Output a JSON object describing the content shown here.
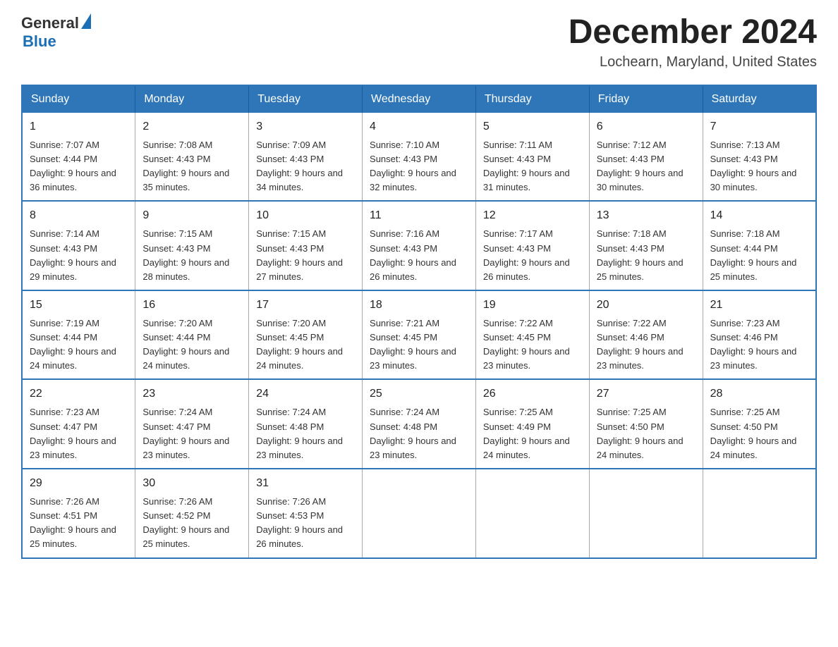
{
  "header": {
    "logo_general": "General",
    "logo_blue": "Blue",
    "month_title": "December 2024",
    "location": "Lochearn, Maryland, United States"
  },
  "weekdays": [
    "Sunday",
    "Monday",
    "Tuesday",
    "Wednesday",
    "Thursday",
    "Friday",
    "Saturday"
  ],
  "weeks": [
    [
      {
        "day": "1",
        "sunrise": "Sunrise: 7:07 AM",
        "sunset": "Sunset: 4:44 PM",
        "daylight": "Daylight: 9 hours and 36 minutes."
      },
      {
        "day": "2",
        "sunrise": "Sunrise: 7:08 AM",
        "sunset": "Sunset: 4:43 PM",
        "daylight": "Daylight: 9 hours and 35 minutes."
      },
      {
        "day": "3",
        "sunrise": "Sunrise: 7:09 AM",
        "sunset": "Sunset: 4:43 PM",
        "daylight": "Daylight: 9 hours and 34 minutes."
      },
      {
        "day": "4",
        "sunrise": "Sunrise: 7:10 AM",
        "sunset": "Sunset: 4:43 PM",
        "daylight": "Daylight: 9 hours and 32 minutes."
      },
      {
        "day": "5",
        "sunrise": "Sunrise: 7:11 AM",
        "sunset": "Sunset: 4:43 PM",
        "daylight": "Daylight: 9 hours and 31 minutes."
      },
      {
        "day": "6",
        "sunrise": "Sunrise: 7:12 AM",
        "sunset": "Sunset: 4:43 PM",
        "daylight": "Daylight: 9 hours and 30 minutes."
      },
      {
        "day": "7",
        "sunrise": "Sunrise: 7:13 AM",
        "sunset": "Sunset: 4:43 PM",
        "daylight": "Daylight: 9 hours and 30 minutes."
      }
    ],
    [
      {
        "day": "8",
        "sunrise": "Sunrise: 7:14 AM",
        "sunset": "Sunset: 4:43 PM",
        "daylight": "Daylight: 9 hours and 29 minutes."
      },
      {
        "day": "9",
        "sunrise": "Sunrise: 7:15 AM",
        "sunset": "Sunset: 4:43 PM",
        "daylight": "Daylight: 9 hours and 28 minutes."
      },
      {
        "day": "10",
        "sunrise": "Sunrise: 7:15 AM",
        "sunset": "Sunset: 4:43 PM",
        "daylight": "Daylight: 9 hours and 27 minutes."
      },
      {
        "day": "11",
        "sunrise": "Sunrise: 7:16 AM",
        "sunset": "Sunset: 4:43 PM",
        "daylight": "Daylight: 9 hours and 26 minutes."
      },
      {
        "day": "12",
        "sunrise": "Sunrise: 7:17 AM",
        "sunset": "Sunset: 4:43 PM",
        "daylight": "Daylight: 9 hours and 26 minutes."
      },
      {
        "day": "13",
        "sunrise": "Sunrise: 7:18 AM",
        "sunset": "Sunset: 4:43 PM",
        "daylight": "Daylight: 9 hours and 25 minutes."
      },
      {
        "day": "14",
        "sunrise": "Sunrise: 7:18 AM",
        "sunset": "Sunset: 4:44 PM",
        "daylight": "Daylight: 9 hours and 25 minutes."
      }
    ],
    [
      {
        "day": "15",
        "sunrise": "Sunrise: 7:19 AM",
        "sunset": "Sunset: 4:44 PM",
        "daylight": "Daylight: 9 hours and 24 minutes."
      },
      {
        "day": "16",
        "sunrise": "Sunrise: 7:20 AM",
        "sunset": "Sunset: 4:44 PM",
        "daylight": "Daylight: 9 hours and 24 minutes."
      },
      {
        "day": "17",
        "sunrise": "Sunrise: 7:20 AM",
        "sunset": "Sunset: 4:45 PM",
        "daylight": "Daylight: 9 hours and 24 minutes."
      },
      {
        "day": "18",
        "sunrise": "Sunrise: 7:21 AM",
        "sunset": "Sunset: 4:45 PM",
        "daylight": "Daylight: 9 hours and 23 minutes."
      },
      {
        "day": "19",
        "sunrise": "Sunrise: 7:22 AM",
        "sunset": "Sunset: 4:45 PM",
        "daylight": "Daylight: 9 hours and 23 minutes."
      },
      {
        "day": "20",
        "sunrise": "Sunrise: 7:22 AM",
        "sunset": "Sunset: 4:46 PM",
        "daylight": "Daylight: 9 hours and 23 minutes."
      },
      {
        "day": "21",
        "sunrise": "Sunrise: 7:23 AM",
        "sunset": "Sunset: 4:46 PM",
        "daylight": "Daylight: 9 hours and 23 minutes."
      }
    ],
    [
      {
        "day": "22",
        "sunrise": "Sunrise: 7:23 AM",
        "sunset": "Sunset: 4:47 PM",
        "daylight": "Daylight: 9 hours and 23 minutes."
      },
      {
        "day": "23",
        "sunrise": "Sunrise: 7:24 AM",
        "sunset": "Sunset: 4:47 PM",
        "daylight": "Daylight: 9 hours and 23 minutes."
      },
      {
        "day": "24",
        "sunrise": "Sunrise: 7:24 AM",
        "sunset": "Sunset: 4:48 PM",
        "daylight": "Daylight: 9 hours and 23 minutes."
      },
      {
        "day": "25",
        "sunrise": "Sunrise: 7:24 AM",
        "sunset": "Sunset: 4:48 PM",
        "daylight": "Daylight: 9 hours and 23 minutes."
      },
      {
        "day": "26",
        "sunrise": "Sunrise: 7:25 AM",
        "sunset": "Sunset: 4:49 PM",
        "daylight": "Daylight: 9 hours and 24 minutes."
      },
      {
        "day": "27",
        "sunrise": "Sunrise: 7:25 AM",
        "sunset": "Sunset: 4:50 PM",
        "daylight": "Daylight: 9 hours and 24 minutes."
      },
      {
        "day": "28",
        "sunrise": "Sunrise: 7:25 AM",
        "sunset": "Sunset: 4:50 PM",
        "daylight": "Daylight: 9 hours and 24 minutes."
      }
    ],
    [
      {
        "day": "29",
        "sunrise": "Sunrise: 7:26 AM",
        "sunset": "Sunset: 4:51 PM",
        "daylight": "Daylight: 9 hours and 25 minutes."
      },
      {
        "day": "30",
        "sunrise": "Sunrise: 7:26 AM",
        "sunset": "Sunset: 4:52 PM",
        "daylight": "Daylight: 9 hours and 25 minutes."
      },
      {
        "day": "31",
        "sunrise": "Sunrise: 7:26 AM",
        "sunset": "Sunset: 4:53 PM",
        "daylight": "Daylight: 9 hours and 26 minutes."
      },
      null,
      null,
      null,
      null
    ]
  ]
}
